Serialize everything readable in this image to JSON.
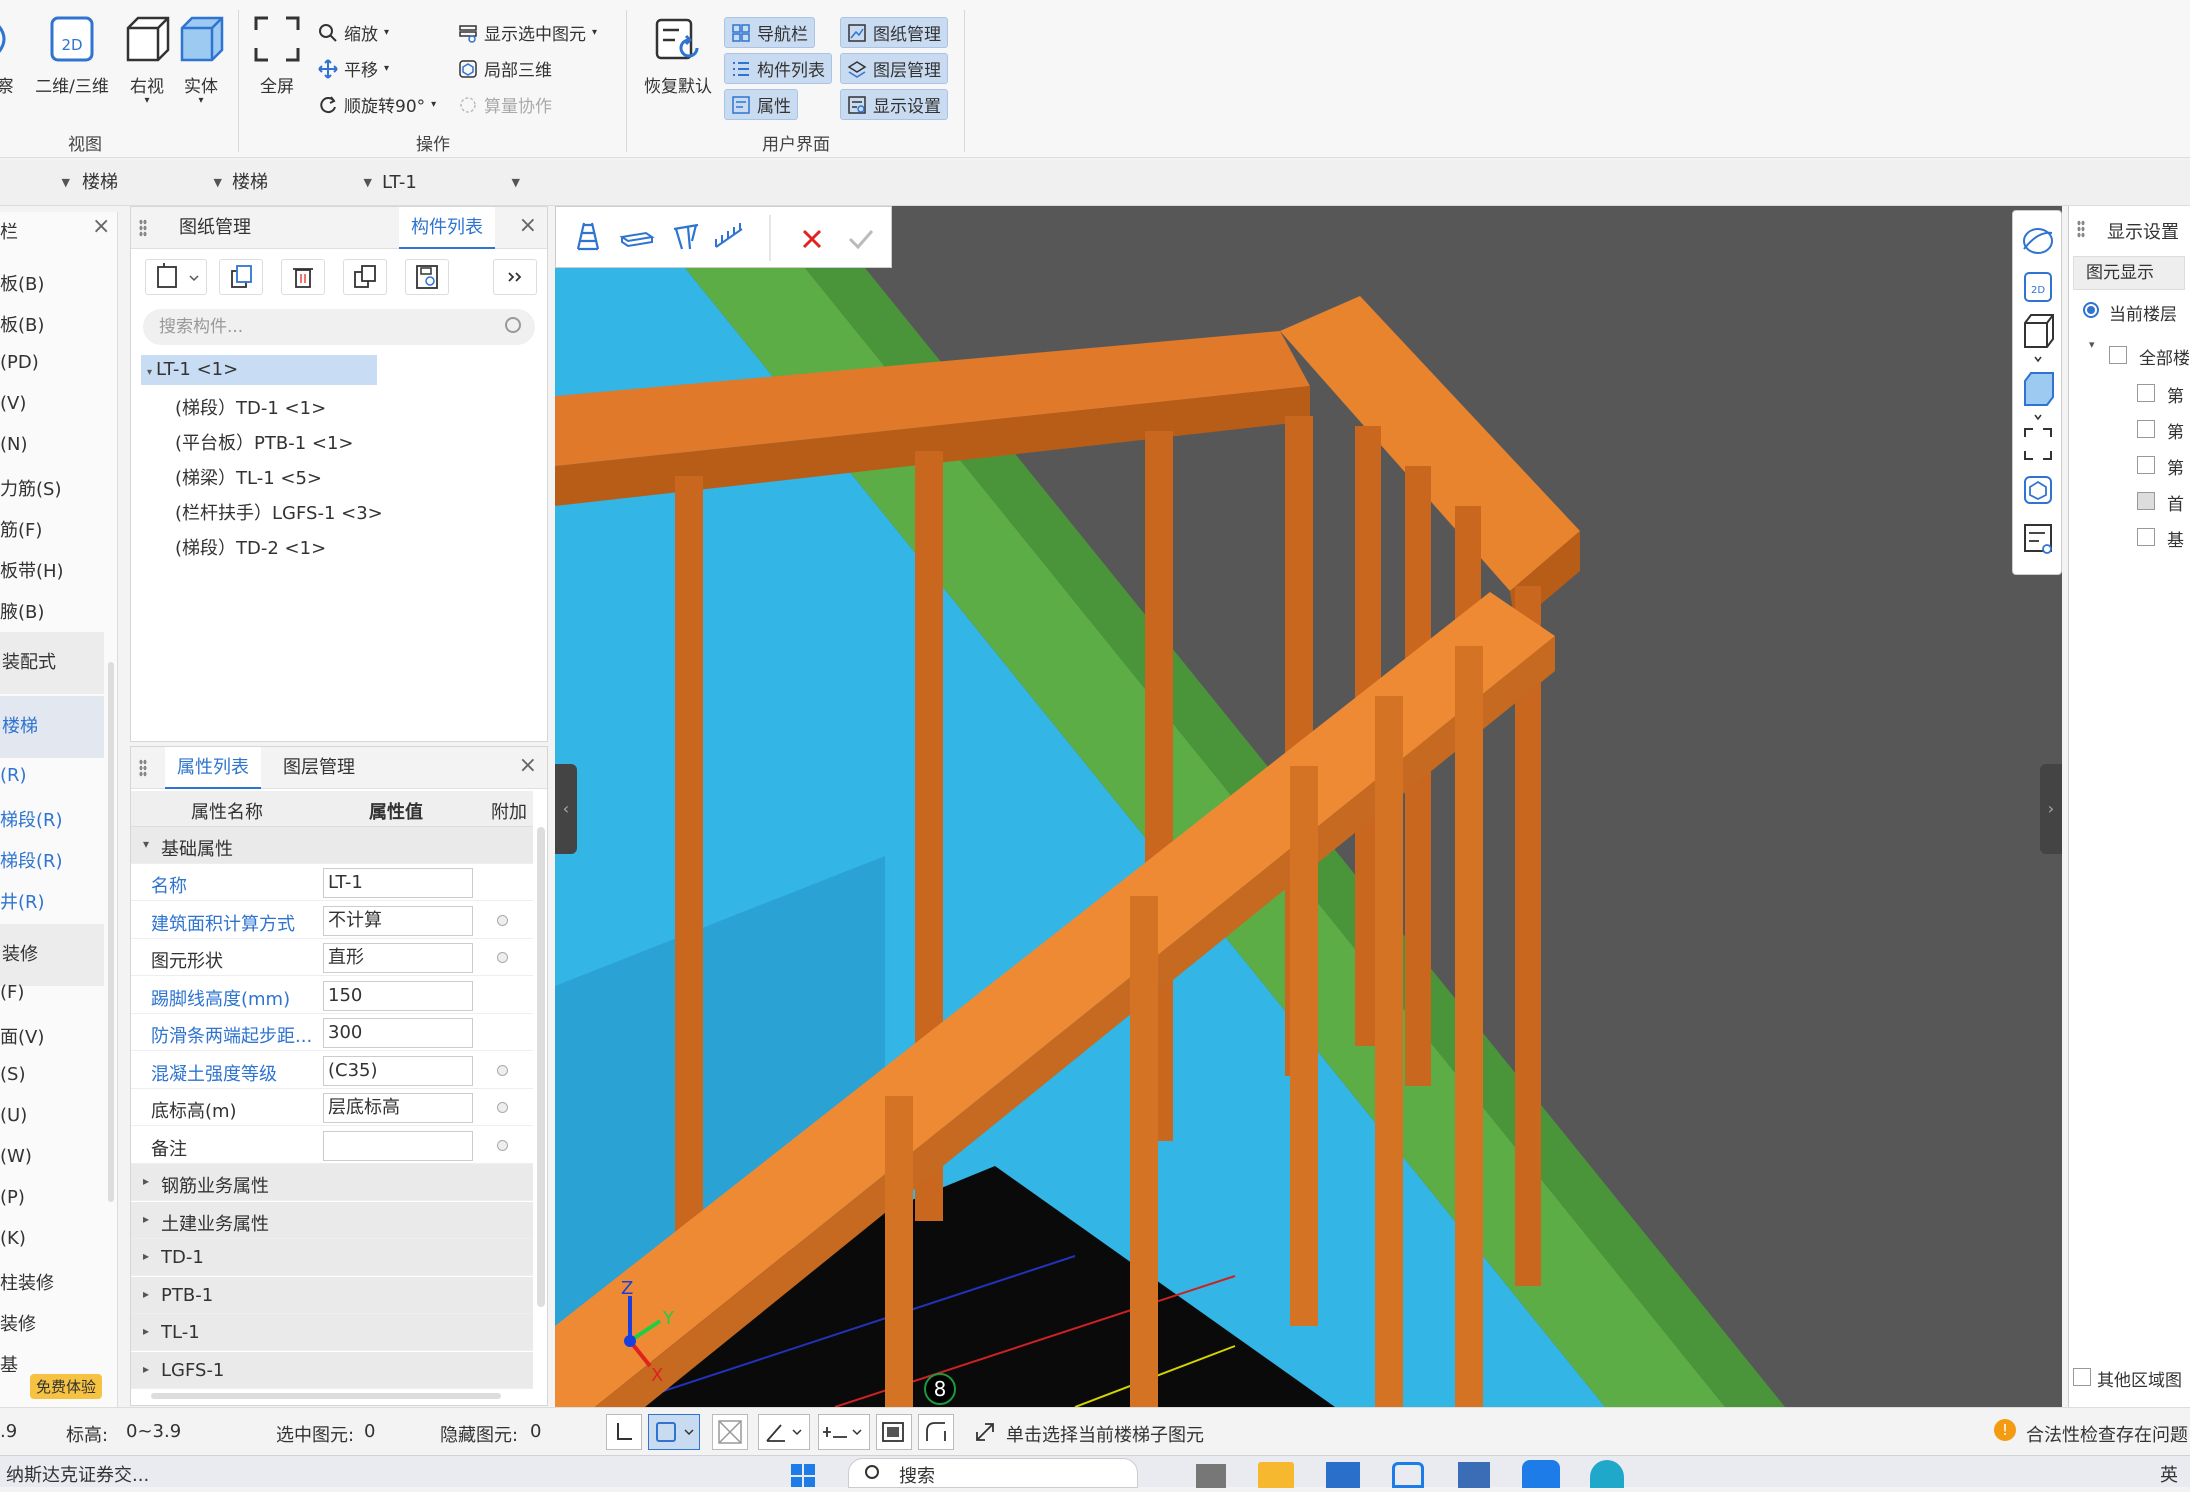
{
  "ribbon": {
    "view_group": {
      "label": "视图",
      "buttons": [
        {
          "label": "察"
        },
        {
          "label": "二维/三维",
          "badge": "2D"
        },
        {
          "label": "右视"
        },
        {
          "label": "实体"
        }
      ]
    },
    "ops_group": {
      "label": "操作",
      "fullscreen": "全屏",
      "zoom": "缩放",
      "pan": "平移",
      "rotate": "顺旋转90°",
      "show_selected": "显示选中图元",
      "local_3d": "局部三维",
      "calc_collab": "算量协作"
    },
    "ui_group": {
      "label": "用户界面",
      "restore": "恢复默认",
      "nav": "导航栏",
      "component_list": "构件列表",
      "properties": "属性",
      "drawing_mgmt": "图纸管理",
      "layer_mgmt": "图层管理",
      "display_settings": "显示设置"
    }
  },
  "selectors": [
    "楼梯",
    "楼梯",
    "LT-1"
  ],
  "left_nav": {
    "close": "×",
    "title_fragment": "栏",
    "items": [
      "板(B)",
      "板(B)",
      "(PD)",
      "(V)",
      "(N)",
      "力筋(S)",
      "筋(F)",
      "板带(H)",
      "腋(B)"
    ],
    "group_prefab": "装配式",
    "group_stairs": "楼梯",
    "stair_items": [
      "(R)",
      "梯段(R)",
      "梯段(R)",
      "井(R)"
    ],
    "group_finish": "装修",
    "finish_items": [
      "(F)",
      "面(V)",
      "(S)",
      "(U)",
      "(W)",
      "(P)",
      "(K)",
      "柱装修",
      "装修",
      "基"
    ],
    "trial_badge": "免费体验"
  },
  "component_panel": {
    "tabs": [
      "图纸管理",
      "构件列表"
    ],
    "active_tab": "构件列表",
    "search_placeholder": "搜索构件...",
    "tree": [
      {
        "label": "LT-1 <1>",
        "selected": true
      },
      {
        "label": "(梯段）TD-1 <1>"
      },
      {
        "label": "(平台板）PTB-1 <1>"
      },
      {
        "label": "(梯梁）TL-1 <5>"
      },
      {
        "label": "(栏杆扶手）LGFS-1 <3>"
      },
      {
        "label": "(梯段）TD-2 <1>"
      }
    ]
  },
  "property_panel": {
    "tabs": [
      "属性列表",
      "图层管理"
    ],
    "headers": [
      "属性名称",
      "属性值",
      "附加"
    ],
    "section_basic": "基础属性",
    "rows": [
      {
        "name": "名称",
        "value": "LT-1",
        "blue": true
      },
      {
        "name": "建筑面积计算方式",
        "value": "不计算",
        "blue": true,
        "dot": true
      },
      {
        "name": "图元形状",
        "value": "直形",
        "dot": true
      },
      {
        "name": "踢脚线高度(mm)",
        "value": "150",
        "blue": true
      },
      {
        "name": "防滑条两端起步距...",
        "value": "300",
        "blue": true
      },
      {
        "name": "混凝土强度等级",
        "value": "(C35)",
        "blue": true,
        "dot": true
      },
      {
        "name": "底标高(m)",
        "value": "层底标高",
        "dot": true
      },
      {
        "name": "备注",
        "value": "",
        "dot": true
      }
    ],
    "sections": [
      "钢筋业务属性",
      "土建业务属性",
      "TD-1",
      "PTB-1",
      "TL-1",
      "LGFS-1"
    ]
  },
  "viewport": {
    "axis_z": "Z",
    "axis_y": "Y",
    "axis_x": "X",
    "grid_marker": "8"
  },
  "right_panel": {
    "title": "显示设置",
    "tab": "图元显示",
    "radio": "当前楼层",
    "all_label": "全部楼",
    "floor_items": [
      "第",
      "第",
      "第",
      "首",
      "基"
    ],
    "other_area": "其他区域图"
  },
  "status": {
    "left_value": ".9",
    "elevation_label": "标高:",
    "elevation_value": "0~3.9",
    "selected_label": "选中图元:",
    "selected_value": "0",
    "hidden_label": "隐藏图元:",
    "hidden_value": "0",
    "hint": "单击选择当前楼梯子图元",
    "warning": "合法性检查存在问题"
  },
  "taskbar": {
    "news": "纳斯达克证券交...",
    "search": "搜索",
    "right_char": "英"
  },
  "colors": {
    "accent": "#2f74d0",
    "railing": "#e67e22",
    "cyan": "#33b5e5",
    "green": "#5cad46"
  }
}
